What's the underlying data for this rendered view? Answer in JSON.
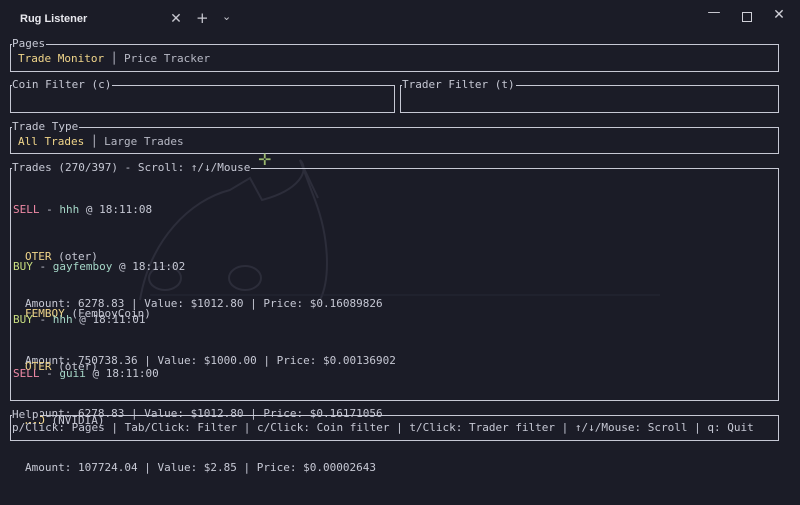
{
  "window": {
    "tab_title": "Rug Listener",
    "tab_close": "✕",
    "new_tab": "+",
    "tab_dropdown": "⌄",
    "minimize": "—",
    "close": "✕"
  },
  "pages": {
    "legend": "Pages",
    "tabs": [
      {
        "label": "Trade Monitor",
        "active": true
      },
      {
        "label": "Price Tracker",
        "active": false
      }
    ]
  },
  "coin_filter": {
    "legend": "Coin Filter (c)",
    "value": ""
  },
  "trader_filter": {
    "legend": "Trader Filter (t)",
    "value": ""
  },
  "trade_type": {
    "legend": "Trade Type",
    "tabs": [
      {
        "label": "All Trades",
        "active": true
      },
      {
        "label": "Large Trades",
        "active": false
      }
    ]
  },
  "trades": {
    "legend": "Trades (270/397) - Scroll: ↑/↓/Mouse",
    "items": [
      {
        "side": "SELL",
        "trader": "hhh",
        "time": "18:11:08",
        "symbol": "OTER",
        "name": "(oter)",
        "amount_line": "Amount: 6278.83 | Value: $1012.80 | Price: $0.16089826"
      },
      {
        "side": "BUY",
        "trader": "gayfemboy",
        "time": "18:11:02",
        "symbol": "FEMBOY",
        "name": "(FemboyCoin)",
        "amount_line": "Amount: 750738.36 | Value: $1000.00 | Price: $0.00136902"
      },
      {
        "side": "BUY",
        "trader": "hhh",
        "time": "18:11:01",
        "symbol": "OTER",
        "name": "(oter)",
        "amount_line": "Amount: 6278.83 | Value: $1012.80 | Price: $0.16171056"
      },
      {
        "side": "SELL",
        "trader": "guii",
        "time": "18:11:00",
        "symbol": "NVD",
        "name": "(NVIDIA)",
        "amount_line": "Amount: 107724.04 | Value: $2.85 | Price: $0.00002643"
      }
    ]
  },
  "help": {
    "legend": "Help",
    "text": "p/Click: Pages | Tab/Click: Filter | c/Click: Coin filter | t/Click: Trader filter | ↑/↓/Mouse: Scroll | q: Quit"
  },
  "colors": {
    "background": "#1b1c27",
    "border": "#c6c8d4",
    "active_tab": "#f0d58a",
    "sell": "#f08aa6",
    "buy": "#c8de80",
    "trader": "#a6d8c8"
  }
}
